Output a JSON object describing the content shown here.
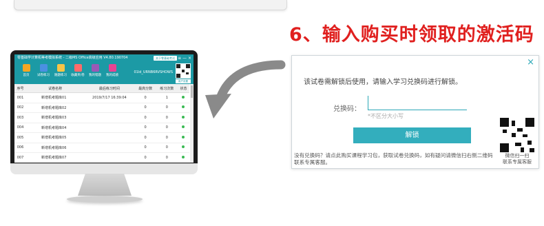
{
  "headline": "6、输入购买时领取的激活码",
  "app": {
    "title": "零基础学计算机等考模拟系统 - 二级MS Office高级应用 V4.80.190704",
    "title_button": "关于零基础考试",
    "title_controls": "≡ — ×",
    "toolbar": [
      "首页",
      "试卷练习",
      "随题练习",
      "收藏夹/卷",
      "我的错题",
      "我的成绩",
      "剩余时间"
    ],
    "user_id": "01ld_URNB6RVSHOWS",
    "save_tag": "用户设置",
    "columns": [
      "序号",
      "试卷名称",
      "最后练习时间",
      "最高分数",
      "练习次数",
      "状态"
    ],
    "rows": [
      {
        "no": "001",
        "name": "新增机考题库01",
        "time": "2019/7/17 16:39:04",
        "score": "0",
        "count": "1"
      },
      {
        "no": "002",
        "name": "新增机考题库02",
        "time": "",
        "score": "0",
        "count": "0"
      },
      {
        "no": "003",
        "name": "新增机考题库03",
        "time": "",
        "score": "0",
        "count": "0"
      },
      {
        "no": "004",
        "name": "新增机考题库04",
        "time": "",
        "score": "0",
        "count": "0"
      },
      {
        "no": "005",
        "name": "新增机考题库05",
        "time": "",
        "score": "0",
        "count": "0"
      },
      {
        "no": "006",
        "name": "新增机考题库06",
        "time": "",
        "score": "0",
        "count": "0"
      },
      {
        "no": "007",
        "name": "新增机考题库07",
        "time": "",
        "score": "0",
        "count": "0"
      }
    ]
  },
  "dialog": {
    "close": "×",
    "message": "该试卷需解锁后使用，请输入学习兑换码进行解锁。",
    "code_label": "兑换码：",
    "code_value": "",
    "hint": "*不区分大小写",
    "unlock_button": "解锁",
    "note": "没有兑换码？请点此购买课程学习包，获取试卷兑换码，如有疑问请微信扫右侧二维码联系专属客服。",
    "qr_caption_1": "微信扫一扫",
    "qr_caption_2": "联系专属客服"
  },
  "colors": {
    "headline": "#e0201f",
    "app_teal": "#1c9aa5",
    "dialog_accent": "#33aebd",
    "status_ok": "#3cba54"
  }
}
